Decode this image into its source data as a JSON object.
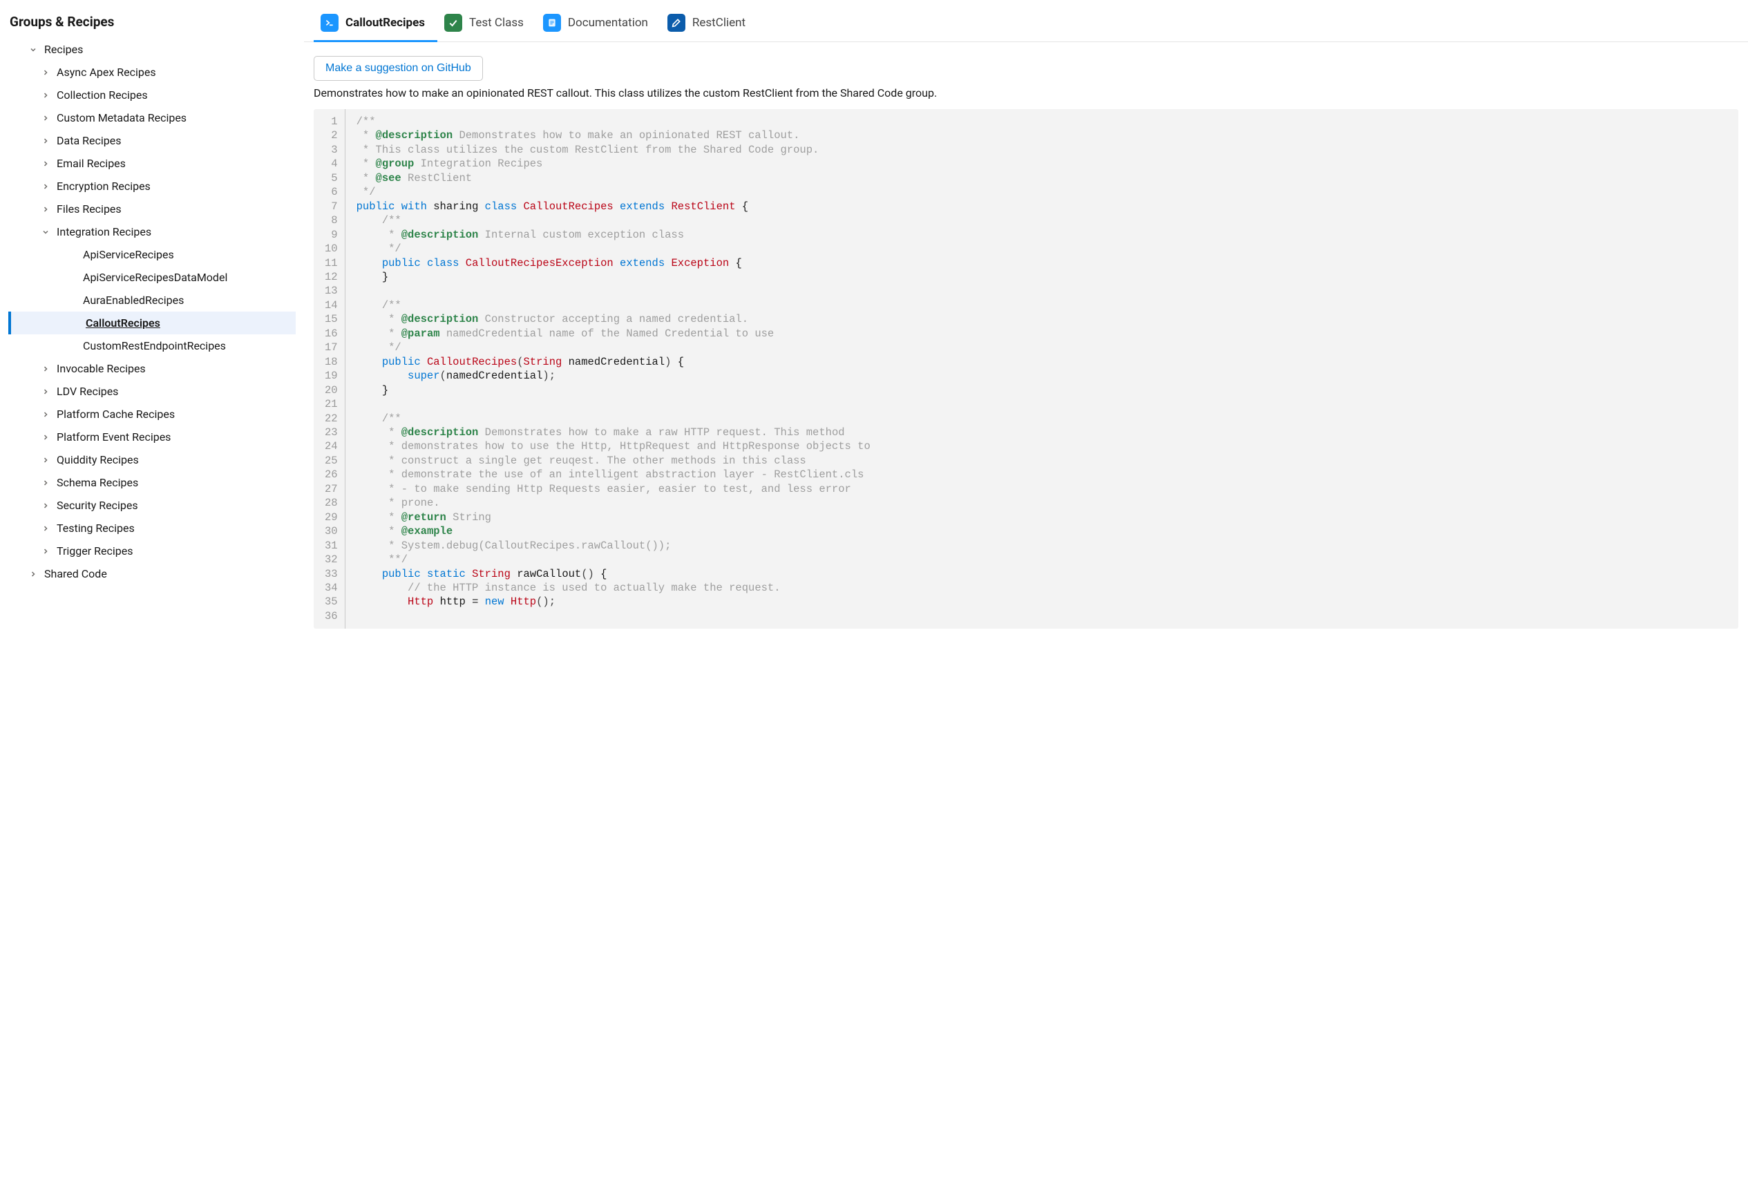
{
  "sidebar": {
    "title": "Groups & Recipes",
    "root": {
      "label": "Recipes"
    },
    "groups": [
      {
        "label": "Async Apex Recipes"
      },
      {
        "label": "Collection Recipes"
      },
      {
        "label": "Custom Metadata Recipes"
      },
      {
        "label": "Data Recipes"
      },
      {
        "label": "Email Recipes"
      },
      {
        "label": "Encryption Recipes"
      },
      {
        "label": "Files Recipes"
      },
      {
        "label": "Integration Recipes",
        "expanded": true,
        "children": [
          {
            "label": "ApiServiceRecipes"
          },
          {
            "label": "ApiServiceRecipesDataModel"
          },
          {
            "label": "AuraEnabledRecipes"
          },
          {
            "label": "CalloutRecipes",
            "selected": true
          },
          {
            "label": "CustomRestEndpointRecipes"
          }
        ]
      },
      {
        "label": "Invocable Recipes"
      },
      {
        "label": "LDV Recipes"
      },
      {
        "label": "Platform Cache Recipes"
      },
      {
        "label": "Platform Event Recipes"
      },
      {
        "label": "Quiddity Recipes"
      },
      {
        "label": "Schema Recipes"
      },
      {
        "label": "Security Recipes"
      },
      {
        "label": "Testing Recipes"
      },
      {
        "label": "Trigger Recipes"
      }
    ],
    "shared": {
      "label": "Shared Code"
    }
  },
  "tabs": [
    {
      "label": "CalloutRecipes",
      "icon": "terminal",
      "color": "blue",
      "active": true
    },
    {
      "label": "Test Class",
      "icon": "check",
      "color": "green"
    },
    {
      "label": "Documentation",
      "icon": "doc",
      "color": "docblue"
    },
    {
      "label": "RestClient",
      "icon": "edit",
      "color": "darkblue"
    }
  ],
  "content": {
    "suggest_label": "Make a suggestion on GitHub",
    "description": "Demonstrates how to make an opinionated REST callout. This class utilizes the custom RestClient from the Shared Code group."
  },
  "code": {
    "line_start": 1,
    "line_end": 36,
    "lines": [
      [
        {
          "c": "comment",
          "t": "/**"
        }
      ],
      [
        {
          "c": "comment",
          "t": " * "
        },
        {
          "c": "tag",
          "t": "@description"
        },
        {
          "c": "comment",
          "t": " Demonstrates how to make an opinionated REST callout."
        }
      ],
      [
        {
          "c": "comment",
          "t": " * This class utilizes the custom RestClient from the Shared Code group."
        }
      ],
      [
        {
          "c": "comment",
          "t": " * "
        },
        {
          "c": "tag",
          "t": "@group"
        },
        {
          "c": "comment",
          "t": " Integration Recipes"
        }
      ],
      [
        {
          "c": "comment",
          "t": " * "
        },
        {
          "c": "tag",
          "t": "@see"
        },
        {
          "c": "comment",
          "t": " RestClient"
        }
      ],
      [
        {
          "c": "comment",
          "t": " */"
        }
      ],
      [
        {
          "c": "keyword",
          "t": "public"
        },
        {
          "c": "plain",
          "t": " "
        },
        {
          "c": "keyword",
          "t": "with"
        },
        {
          "c": "plain",
          "t": " sharing "
        },
        {
          "c": "keyword",
          "t": "class"
        },
        {
          "c": "plain",
          "t": " "
        },
        {
          "c": "classname",
          "t": "CalloutRecipes"
        },
        {
          "c": "plain",
          "t": " "
        },
        {
          "c": "keyword",
          "t": "extends"
        },
        {
          "c": "plain",
          "t": " "
        },
        {
          "c": "classname",
          "t": "RestClient"
        },
        {
          "c": "plain",
          "t": " {"
        }
      ],
      [
        {
          "c": "plain",
          "t": "    "
        },
        {
          "c": "comment",
          "t": "/**"
        }
      ],
      [
        {
          "c": "plain",
          "t": "    "
        },
        {
          "c": "comment",
          "t": " * "
        },
        {
          "c": "tag",
          "t": "@description"
        },
        {
          "c": "comment",
          "t": " Internal custom exception class"
        }
      ],
      [
        {
          "c": "plain",
          "t": "    "
        },
        {
          "c": "comment",
          "t": " */"
        }
      ],
      [
        {
          "c": "plain",
          "t": "    "
        },
        {
          "c": "keyword",
          "t": "public"
        },
        {
          "c": "plain",
          "t": " "
        },
        {
          "c": "keyword",
          "t": "class"
        },
        {
          "c": "plain",
          "t": " "
        },
        {
          "c": "classname",
          "t": "CalloutRecipesException"
        },
        {
          "c": "plain",
          "t": " "
        },
        {
          "c": "keyword",
          "t": "extends"
        },
        {
          "c": "plain",
          "t": " "
        },
        {
          "c": "classname",
          "t": "Exception"
        },
        {
          "c": "plain",
          "t": " {"
        }
      ],
      [
        {
          "c": "plain",
          "t": "    }"
        }
      ],
      [
        {
          "c": "plain",
          "t": ""
        }
      ],
      [
        {
          "c": "plain",
          "t": "    "
        },
        {
          "c": "comment",
          "t": "/**"
        }
      ],
      [
        {
          "c": "plain",
          "t": "    "
        },
        {
          "c": "comment",
          "t": " * "
        },
        {
          "c": "tag",
          "t": "@description"
        },
        {
          "c": "comment",
          "t": " Constructor accepting a named credential."
        }
      ],
      [
        {
          "c": "plain",
          "t": "    "
        },
        {
          "c": "comment",
          "t": " * "
        },
        {
          "c": "tag",
          "t": "@param"
        },
        {
          "c": "comment",
          "t": " namedCredential name of the Named Credential to use"
        }
      ],
      [
        {
          "c": "plain",
          "t": "    "
        },
        {
          "c": "comment",
          "t": " */"
        }
      ],
      [
        {
          "c": "plain",
          "t": "    "
        },
        {
          "c": "keyword",
          "t": "public"
        },
        {
          "c": "plain",
          "t": " "
        },
        {
          "c": "classname",
          "t": "CalloutRecipes"
        },
        {
          "c": "punct",
          "t": "("
        },
        {
          "c": "classname",
          "t": "String"
        },
        {
          "c": "plain",
          "t": " "
        },
        {
          "c": "ident",
          "t": "namedCredential"
        },
        {
          "c": "punct",
          "t": ")"
        },
        {
          "c": "plain",
          "t": " {"
        }
      ],
      [
        {
          "c": "plain",
          "t": "        "
        },
        {
          "c": "keyword",
          "t": "super"
        },
        {
          "c": "punct",
          "t": "("
        },
        {
          "c": "ident",
          "t": "namedCredential"
        },
        {
          "c": "punct",
          "t": ");"
        }
      ],
      [
        {
          "c": "plain",
          "t": "    }"
        }
      ],
      [
        {
          "c": "plain",
          "t": ""
        }
      ],
      [
        {
          "c": "plain",
          "t": "    "
        },
        {
          "c": "comment",
          "t": "/**"
        }
      ],
      [
        {
          "c": "plain",
          "t": "    "
        },
        {
          "c": "comment",
          "t": " * "
        },
        {
          "c": "tag",
          "t": "@description"
        },
        {
          "c": "comment",
          "t": " Demonstrates how to make a raw HTTP request. This method"
        }
      ],
      [
        {
          "c": "plain",
          "t": "    "
        },
        {
          "c": "comment",
          "t": " * demonstrates how to use the Http, HttpRequest and HttpResponse objects to"
        }
      ],
      [
        {
          "c": "plain",
          "t": "    "
        },
        {
          "c": "comment",
          "t": " * construct a single get reuqest. The other methods in this class"
        }
      ],
      [
        {
          "c": "plain",
          "t": "    "
        },
        {
          "c": "comment",
          "t": " * demonstrate the use of an intelligent abstraction layer - RestClient.cls"
        }
      ],
      [
        {
          "c": "plain",
          "t": "    "
        },
        {
          "c": "comment",
          "t": " * - to make sending Http Requests easier, easier to test, and less error"
        }
      ],
      [
        {
          "c": "plain",
          "t": "    "
        },
        {
          "c": "comment",
          "t": " * prone."
        }
      ],
      [
        {
          "c": "plain",
          "t": "    "
        },
        {
          "c": "comment",
          "t": " * "
        },
        {
          "c": "tag",
          "t": "@return"
        },
        {
          "c": "comment",
          "t": " String"
        }
      ],
      [
        {
          "c": "plain",
          "t": "    "
        },
        {
          "c": "comment",
          "t": " * "
        },
        {
          "c": "tag",
          "t": "@example"
        }
      ],
      [
        {
          "c": "plain",
          "t": "    "
        },
        {
          "c": "comment",
          "t": " * System.debug(CalloutRecipes.rawCallout());"
        }
      ],
      [
        {
          "c": "plain",
          "t": "    "
        },
        {
          "c": "comment",
          "t": " **/"
        }
      ],
      [
        {
          "c": "plain",
          "t": "    "
        },
        {
          "c": "keyword",
          "t": "public"
        },
        {
          "c": "plain",
          "t": " "
        },
        {
          "c": "keyword",
          "t": "static"
        },
        {
          "c": "plain",
          "t": " "
        },
        {
          "c": "classname",
          "t": "String"
        },
        {
          "c": "plain",
          "t": " "
        },
        {
          "c": "ident",
          "t": "rawCallout"
        },
        {
          "c": "punct",
          "t": "()"
        },
        {
          "c": "plain",
          "t": " {"
        }
      ],
      [
        {
          "c": "plain",
          "t": "        "
        },
        {
          "c": "comment",
          "t": "// the HTTP instance is used to actually make the request."
        }
      ],
      [
        {
          "c": "plain",
          "t": "        "
        },
        {
          "c": "classname",
          "t": "Http"
        },
        {
          "c": "plain",
          "t": " "
        },
        {
          "c": "ident",
          "t": "http"
        },
        {
          "c": "plain",
          "t": " = "
        },
        {
          "c": "keyword",
          "t": "new"
        },
        {
          "c": "plain",
          "t": " "
        },
        {
          "c": "classname",
          "t": "Http"
        },
        {
          "c": "punct",
          "t": "();"
        }
      ]
    ]
  }
}
